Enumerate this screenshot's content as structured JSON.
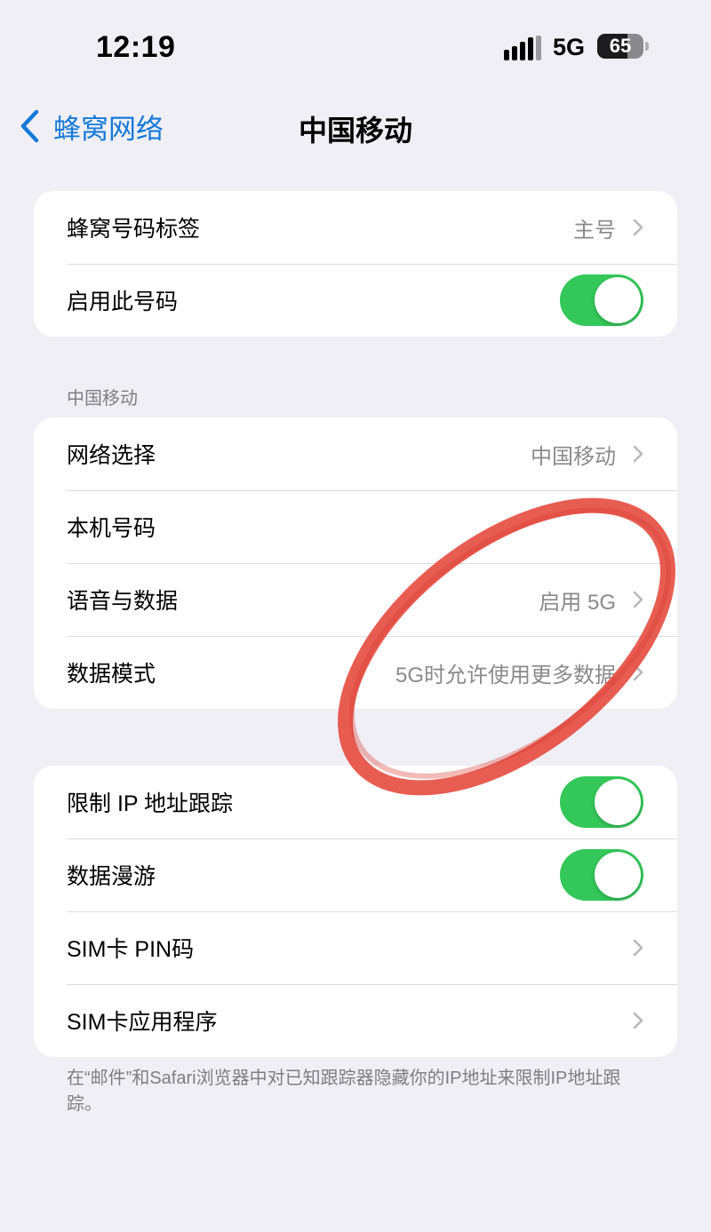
{
  "status_bar": {
    "time": "12:19",
    "network": "5G",
    "battery_percent": 65,
    "battery_text": "65"
  },
  "nav": {
    "back_label": "蜂窝网络",
    "title": "中国移动"
  },
  "group1": {
    "label_row": {
      "label": "蜂窝号码标签",
      "value": "主号"
    },
    "enable_row": {
      "label": "启用此号码",
      "on": true
    }
  },
  "section_header": "中国移动",
  "group2": {
    "network_selection": {
      "label": "网络选择",
      "value": "中国移动"
    },
    "my_number": {
      "label": "本机号码"
    },
    "voice_data": {
      "label": "语音与数据",
      "value": "启用 5G"
    },
    "data_mode": {
      "label": "数据模式",
      "value": "5G时允许使用更多数据"
    }
  },
  "group3": {
    "limit_ip": {
      "label": "限制 IP 地址跟踪",
      "on": true
    },
    "data_roaming": {
      "label": "数据漫游",
      "on": true
    },
    "sim_pin": {
      "label": "SIM卡 PIN码"
    },
    "sim_apps": {
      "label": "SIM卡应用程序"
    }
  },
  "footer_note": "在“邮件”和Safari浏览器中对已知跟踪器隐藏你的IP地址来限制IP地址跟踪。",
  "colors": {
    "accent": "#1479d8",
    "toggle_on": "#34c759",
    "annotation_red": "#e5473a"
  }
}
